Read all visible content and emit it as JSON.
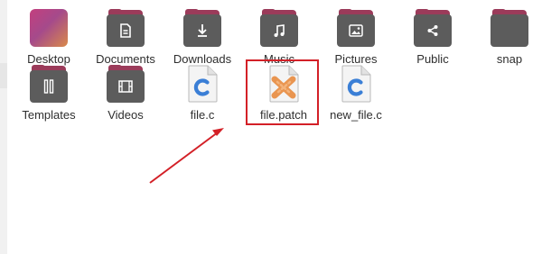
{
  "files": [
    {
      "label": "Desktop",
      "kind": "folder",
      "icon": "desktop-folder-icon"
    },
    {
      "label": "Documents",
      "kind": "folder",
      "icon": "documents-folder-icon"
    },
    {
      "label": "Downloads",
      "kind": "folder",
      "icon": "downloads-folder-icon"
    },
    {
      "label": "Music",
      "kind": "folder",
      "icon": "music-folder-icon"
    },
    {
      "label": "Pictures",
      "kind": "folder",
      "icon": "pictures-folder-icon"
    },
    {
      "label": "Public",
      "kind": "folder",
      "icon": "public-folder-icon"
    },
    {
      "label": "snap",
      "kind": "folder",
      "icon": "folder-icon"
    },
    {
      "label": "Templates",
      "kind": "folder",
      "icon": "templates-folder-icon"
    },
    {
      "label": "Videos",
      "kind": "folder",
      "icon": "videos-folder-icon"
    },
    {
      "label": "file.c",
      "kind": "file",
      "icon": "c-source-file-icon"
    },
    {
      "label": "file.patch",
      "kind": "file",
      "icon": "patch-file-icon"
    },
    {
      "label": "new_file.c",
      "kind": "file",
      "icon": "c-source-file-icon"
    }
  ],
  "annotation": {
    "highlighted_item": "file.patch",
    "color": "#d32027"
  },
  "colors": {
    "folder_body": "#5c5c5c",
    "folder_back": "#9b3b5a",
    "c_letter": "#3b7fd6"
  }
}
